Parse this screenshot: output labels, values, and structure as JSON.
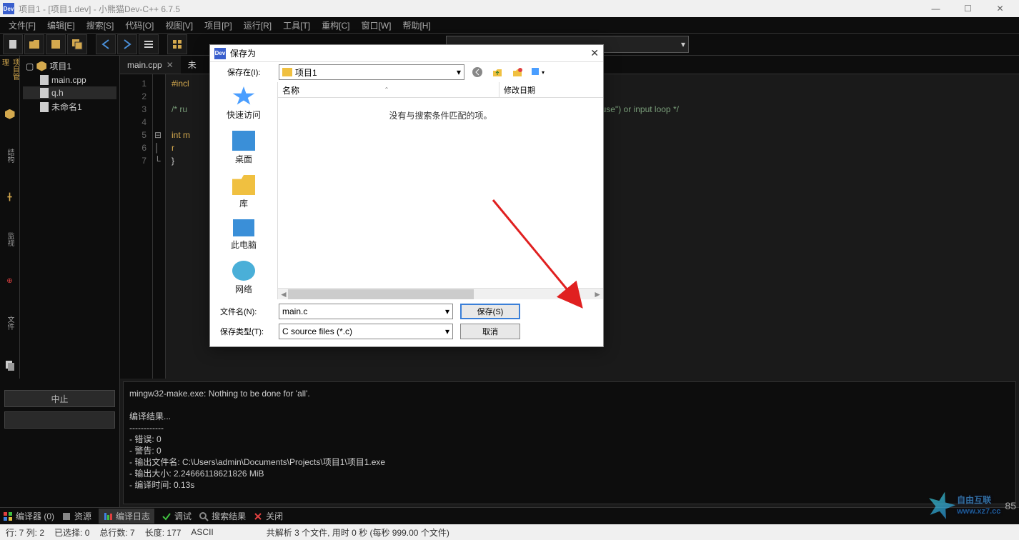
{
  "title": "项目1 - [项目1.dev] - 小熊猫Dev-C++ 6.7.5",
  "menu": [
    "文件[F]",
    "编辑[E]",
    "搜索[S]",
    "代码[O]",
    "视图[V]",
    "项目[P]",
    "运行[R]",
    "工具[T]",
    "重构[C]",
    "窗口[W]",
    "帮助[H]"
  ],
  "project": {
    "root": "项目1",
    "files": [
      "main.cpp",
      "q.h",
      "未命名1"
    ]
  },
  "editor_tabs": [
    {
      "label": "main.cpp",
      "active": true
    },
    {
      "label": "未",
      "active": false
    }
  ],
  "code": {
    "lines": [
      {
        "n": 1,
        "txt": "#incl"
      },
      {
        "n": 2,
        "txt": ""
      },
      {
        "n": 3,
        "txt": "/* ru",
        "tail": "system(\"pause\") or input loop */"
      },
      {
        "n": 4,
        "txt": ""
      },
      {
        "n": 5,
        "txt": "int m"
      },
      {
        "n": 6,
        "txt": "    r"
      },
      {
        "n": 7,
        "txt": "}"
      }
    ]
  },
  "buttons": {
    "stop": "中止"
  },
  "compile": {
    "line1": "mingw32-make.exe: Nothing to be done for 'all'.",
    "header": "编译结果...",
    "sep": "------------",
    "errors": "- 错误: 0",
    "warnings": "- 警告: 0",
    "output_file": "- 输出文件名: C:\\Users\\admin\\Documents\\Projects\\项目1\\项目1.exe",
    "output_size": "- 输出大小: 2.24666118621826 MiB",
    "compile_time": "- 编译时间: 0.13s"
  },
  "bottom_tools": [
    {
      "label": "编译器 (0)"
    },
    {
      "label": "资源"
    },
    {
      "label": "编译日志",
      "active": true
    },
    {
      "label": "调试"
    },
    {
      "label": "搜索结果"
    },
    {
      "label": "关闭"
    }
  ],
  "status": {
    "line_col": "行:  7  列:  2",
    "sel": "已选择:  0",
    "total": "总行数:  7",
    "len": "长度:  177",
    "enc": "ASCII",
    "parse": "共解析 3 个文件, 用时 0 秒 (每秒 999.00 个文件)"
  },
  "dialog": {
    "title": "保存为",
    "save_in_label": "保存在(I):",
    "folder": "项目1",
    "sidebar": [
      "快速访问",
      "桌面",
      "库",
      "此电脑",
      "网络"
    ],
    "cols": {
      "name": "名称",
      "date": "修改日期"
    },
    "empty_msg": "没有与搜索条件匹配的项。",
    "filename_label": "文件名(N):",
    "filename_value": "main.c",
    "filetype_label": "保存类型(T):",
    "filetype_value": "C source files (*.c)",
    "save_btn": "保存(S)",
    "cancel_btn": "取消"
  },
  "watermark": {
    "a": "自由互联",
    "b": "www.xz7.cc"
  },
  "watermark_right": "85"
}
